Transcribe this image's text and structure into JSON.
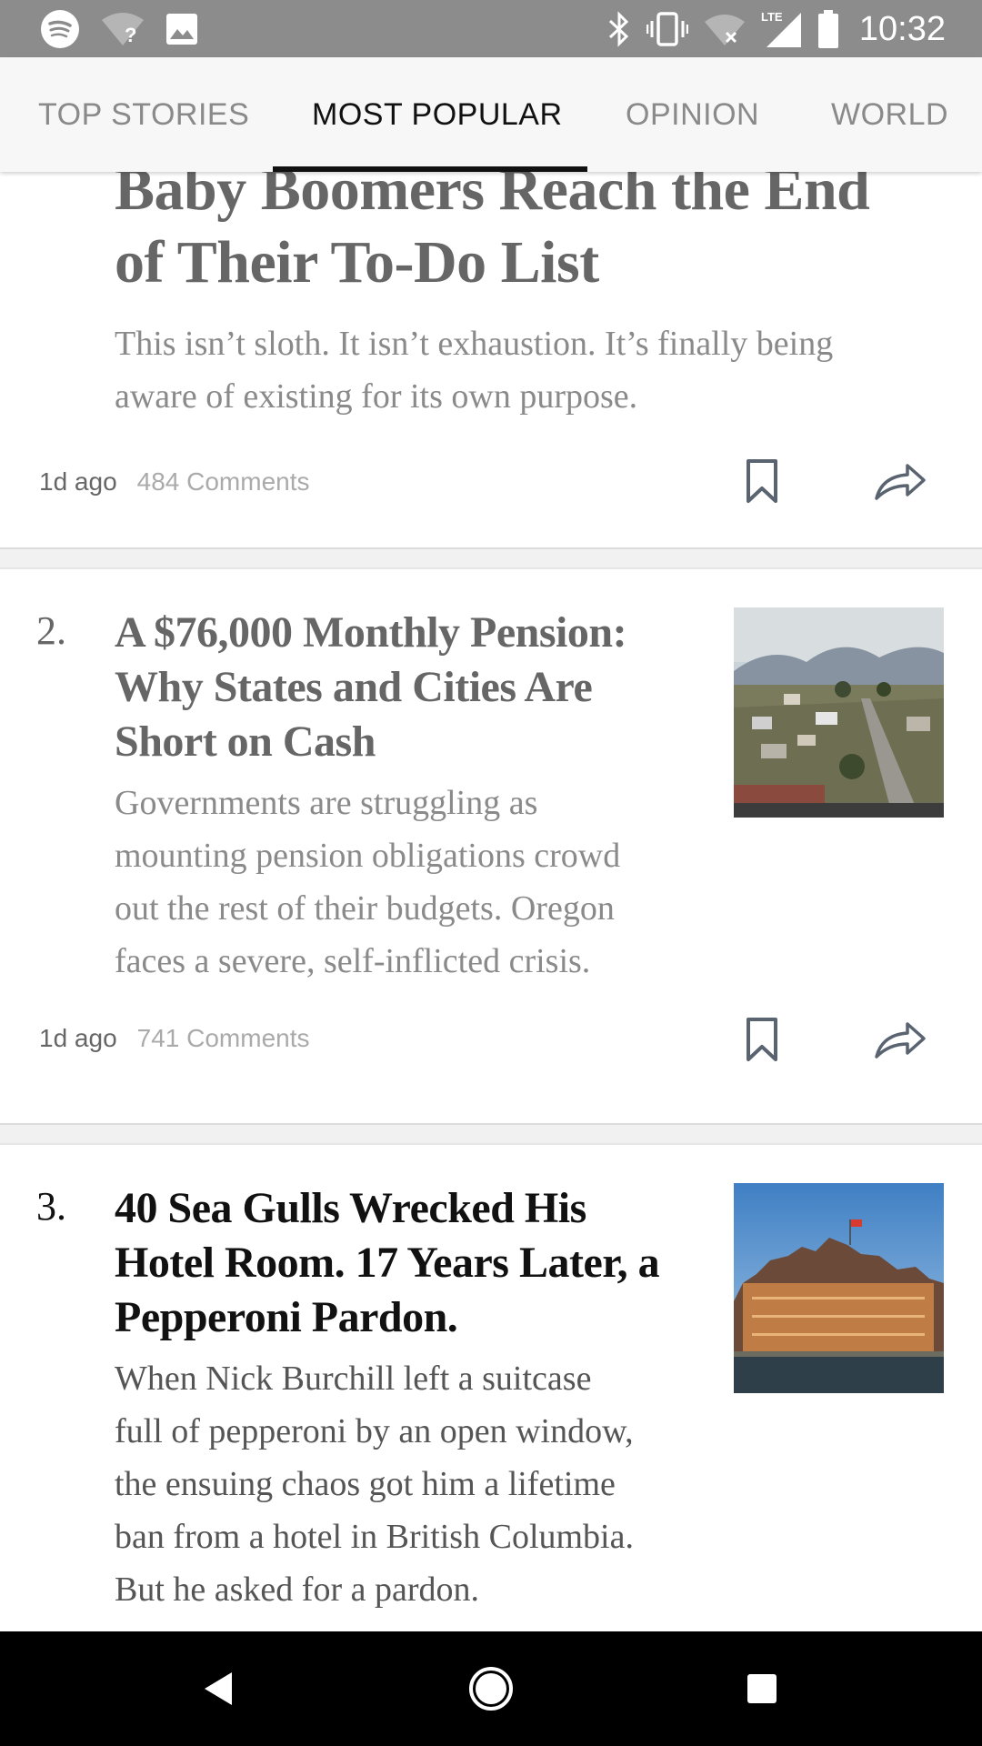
{
  "status_bar": {
    "time": "10:32",
    "left_icons": [
      "spotify-icon",
      "wifi-unknown-icon",
      "image-icon"
    ],
    "right_icons": [
      "bluetooth-icon",
      "vibrate-icon",
      "wifi-off-icon",
      "lte-signal-icon",
      "battery-icon"
    ],
    "lte_label": "LTE"
  },
  "tabs": [
    {
      "label": "TOP STORIES",
      "active": false
    },
    {
      "label": "MOST POPULAR",
      "active": true
    },
    {
      "label": "OPINION",
      "active": false
    },
    {
      "label": "WORLD",
      "active": false
    }
  ],
  "articles": [
    {
      "rank": "",
      "headline": [
        "Baby Boomers Reach the End",
        "of Their To-Do List"
      ],
      "summary": [
        "This isn’t sloth. It isn’t exhaustion. It’s finally being",
        "aware of existing for its own purpose."
      ],
      "time": "1d ago",
      "comments": "484 Comments"
    },
    {
      "rank": "2.",
      "headline": [
        "A $76,000 Monthly Pension:",
        "Why States and Cities Are",
        "Short on Cash"
      ],
      "summary": [
        "Governments are struggling as",
        "mounting pension obligations crowd",
        "out the rest of their budgets. Oregon",
        "faces a severe, self-inflicted crisis."
      ],
      "time": "1d ago",
      "comments": "741 Comments",
      "image": "town-hillside-photo"
    },
    {
      "rank": "3.",
      "headline": [
        "40 Sea Gulls Wrecked His",
        "Hotel Room. 17 Years Later, a",
        "Pepperoni Pardon."
      ],
      "summary": [
        "When Nick Burchill left a suitcase",
        "full of pepperoni by an open window,",
        "the ensuing chaos got him a lifetime",
        "ban from a hotel in British Columbia.",
        "But he asked for a pardon."
      ],
      "image": "historic-hotel-photo"
    }
  ],
  "nav_bar": {
    "buttons": [
      "back-icon",
      "home-icon",
      "recents-icon"
    ]
  },
  "colors": {
    "status_bar": "#8c8c8c",
    "tab_bar": "#f7f7f7",
    "active_tab": "#111111",
    "inactive_tab": "#8a8a8a",
    "divider": "#f1f1f1"
  }
}
